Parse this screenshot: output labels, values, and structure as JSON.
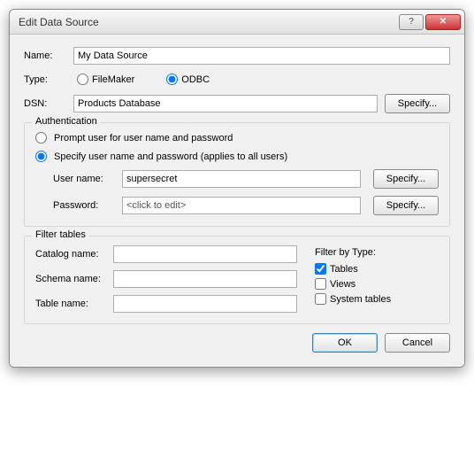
{
  "window": {
    "title": "Edit Data Source"
  },
  "labels": {
    "name": "Name:",
    "type": "Type:",
    "dsn": "DSN:",
    "specify": "Specify...",
    "ok": "OK",
    "cancel": "Cancel"
  },
  "name_value": "My Data Source",
  "type": {
    "filemaker": "FileMaker",
    "odbc": "ODBC",
    "selected": "odbc"
  },
  "dsn_value": "Products Database",
  "auth": {
    "legend": "Authentication",
    "prompt": "Prompt user for user name and password",
    "specify": "Specify user name and password (applies to all users)",
    "selected": "specify",
    "username_label": "User name:",
    "username_value": "supersecret",
    "password_label": "Password:",
    "password_value": "<click to edit>"
  },
  "filter": {
    "legend": "Filter tables",
    "catalog_label": "Catalog name:",
    "catalog_value": "",
    "schema_label": "Schema name:",
    "schema_value": "",
    "table_label": "Table name:",
    "table_value": "",
    "bytype_label": "Filter by Type:",
    "tables": "Tables",
    "views": "Views",
    "system": "System tables",
    "checked": {
      "tables": true,
      "views": false,
      "system": false
    }
  }
}
